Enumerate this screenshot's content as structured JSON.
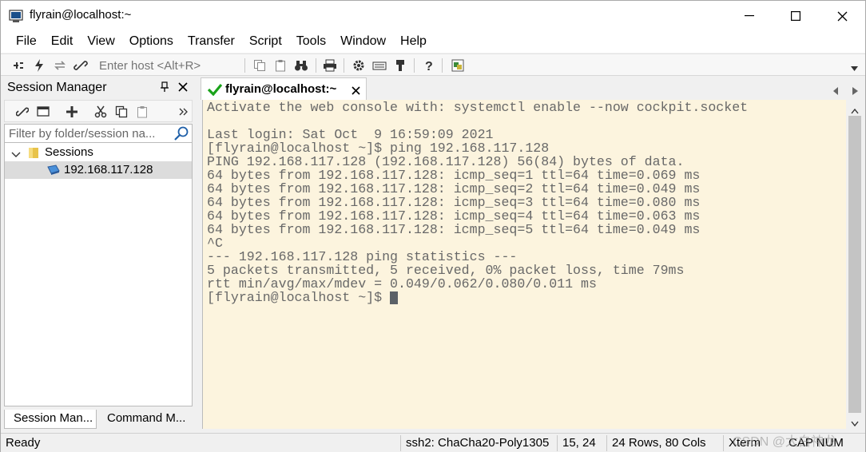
{
  "window": {
    "title": "flyrain@localhost:~"
  },
  "menu": [
    "File",
    "Edit",
    "View",
    "Options",
    "Transfer",
    "Script",
    "Tools",
    "Window",
    "Help"
  ],
  "toolbar": {
    "enter_host_placeholder": "Enter host <Alt+R>"
  },
  "session_manager": {
    "title": "Session Manager",
    "filter_placeholder": "Filter by folder/session na...",
    "tree": {
      "folder_label": "Sessions",
      "host_label": "192.168.117.128"
    },
    "tabs": [
      "Session Man...",
      "Command M..."
    ]
  },
  "session_tab": {
    "label": "flyrain@localhost:~"
  },
  "terminal": {
    "lines": [
      "Activate the web console with: systemctl enable --now cockpit.socket",
      "",
      "Last login: Sat Oct  9 16:59:09 2021",
      "[flyrain@localhost ~]$ ping 192.168.117.128",
      "PING 192.168.117.128 (192.168.117.128) 56(84) bytes of data.",
      "64 bytes from 192.168.117.128: icmp_seq=1 ttl=64 time=0.069 ms",
      "64 bytes from 192.168.117.128: icmp_seq=2 ttl=64 time=0.049 ms",
      "64 bytes from 192.168.117.128: icmp_seq=3 ttl=64 time=0.080 ms",
      "64 bytes from 192.168.117.128: icmp_seq=4 ttl=64 time=0.063 ms",
      "64 bytes from 192.168.117.128: icmp_seq=5 ttl=64 time=0.049 ms",
      "^C",
      "--- 192.168.117.128 ping statistics ---",
      "5 packets transmitted, 5 received, 0% packet loss, time 79ms",
      "rtt min/avg/max/mdev = 0.049/0.062/0.080/0.011 ms",
      "[flyrain@localhost ~]$ "
    ],
    "background": "#fcf4de",
    "foreground": "#686868"
  },
  "status": {
    "ready": "Ready",
    "cipher": "ssh2: ChaCha20-Poly1305",
    "cursor_pos": "15,  24",
    "size": "24 Rows, 80 Cols",
    "term_type": "Xterm",
    "keys": "CAP NUM"
  },
  "watermark": "CSDN @太白神龙"
}
